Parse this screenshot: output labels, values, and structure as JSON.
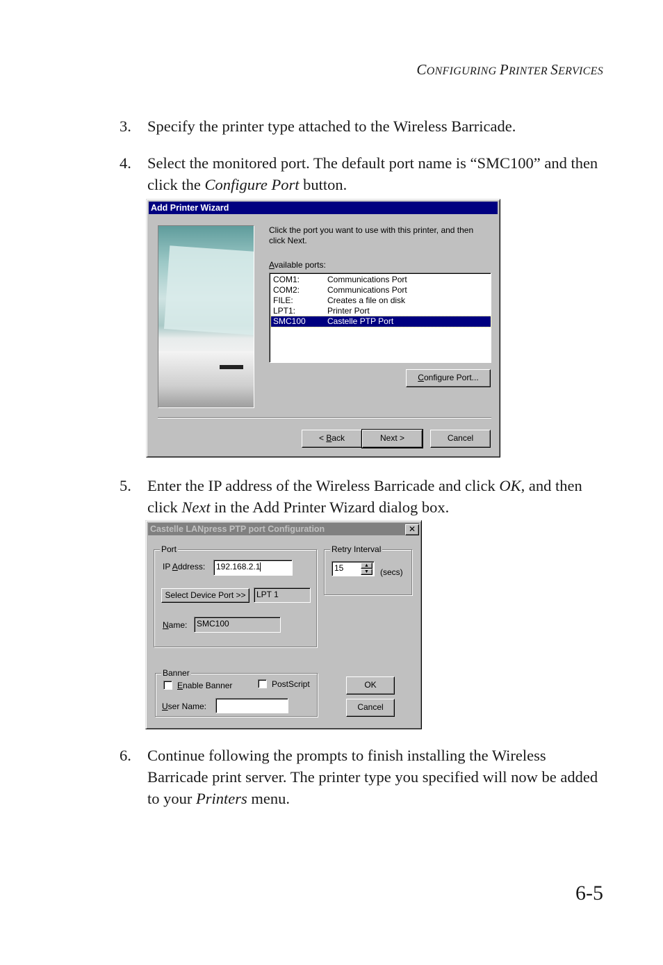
{
  "header": {
    "running_head_parts": [
      {
        "cap": "C",
        "rest": "onfiguring "
      },
      {
        "cap": "P",
        "rest": "rinter "
      },
      {
        "cap": "S",
        "rest": "ervices"
      }
    ]
  },
  "steps": [
    {
      "number": "3.",
      "segments": [
        {
          "t": "Specify the printer type attached to the Wireless Barricade."
        }
      ]
    },
    {
      "number": "4.",
      "segments": [
        {
          "t": "Select the monitored port. The default port name is “SMC100” and then click the "
        },
        {
          "t": "Configure Port",
          "italic": true
        },
        {
          "t": " button."
        }
      ]
    },
    {
      "number": "5.",
      "segments": [
        {
          "t": "Enter the IP address of the Wireless Barricade and click "
        },
        {
          "t": "OK",
          "italic": true
        },
        {
          "t": ", and then click "
        },
        {
          "t": "Next",
          "italic": true
        },
        {
          "t": " in the Add Printer Wizard dialog box."
        }
      ]
    },
    {
      "number": "6.",
      "segments": [
        {
          "t": "Continue following the prompts to finish installing the Wireless Barricade print server. The printer type you specified will now be added to your "
        },
        {
          "t": "Printers",
          "italic": true
        },
        {
          "t": " menu."
        }
      ]
    }
  ],
  "wizard": {
    "title": "Add Printer Wizard",
    "instruction": "Click the port you want to use with this printer, and then click Next.",
    "ports_label_access": "A",
    "ports_label_rest": "vailable ports:",
    "ports": [
      {
        "port": "COM1:",
        "description": "Communications Port",
        "selected": false
      },
      {
        "port": "COM2:",
        "description": "Communications Port",
        "selected": false
      },
      {
        "port": "FILE:",
        "description": "Creates a file on disk",
        "selected": false
      },
      {
        "port": "LPT1:",
        "description": "Printer Port",
        "selected": false
      },
      {
        "port": "SMC100",
        "description": "Castelle  PTP  Port",
        "selected": true
      }
    ],
    "configure_access": "C",
    "configure_rest": "onfigure Port...",
    "back_pre": "< ",
    "back_access": "B",
    "back_rest": "ack",
    "next_label": "Next >",
    "cancel_label": "Cancel"
  },
  "config": {
    "title": "Castelle LANpress PTP port  Configuration",
    "close_glyph": "✕",
    "port_group": "Port",
    "ip_label_pre": "IP ",
    "ip_label_access": "A",
    "ip_label_rest": "ddress:",
    "ip_value": "192.168.2.1",
    "select_device_port": "Select Device Port >>",
    "device_port_value": "LPT 1",
    "name_access": "N",
    "name_rest": "ame:",
    "name_value": "SMC100",
    "retry_group": "Retry Interval",
    "retry_value": "15",
    "retry_unit": "(secs)",
    "banner_group": "Banner",
    "enable_banner_access": "E",
    "enable_banner_rest": "nable Banner",
    "enable_banner_checked": false,
    "postscript_label": "PostScript",
    "postscript_checked": false,
    "user_name_access": "U",
    "user_name_rest": "ser Name:",
    "user_name_value": "",
    "ok_label": "OK",
    "cancel_label": "Cancel"
  },
  "footer": {
    "page_number": "6-5"
  }
}
